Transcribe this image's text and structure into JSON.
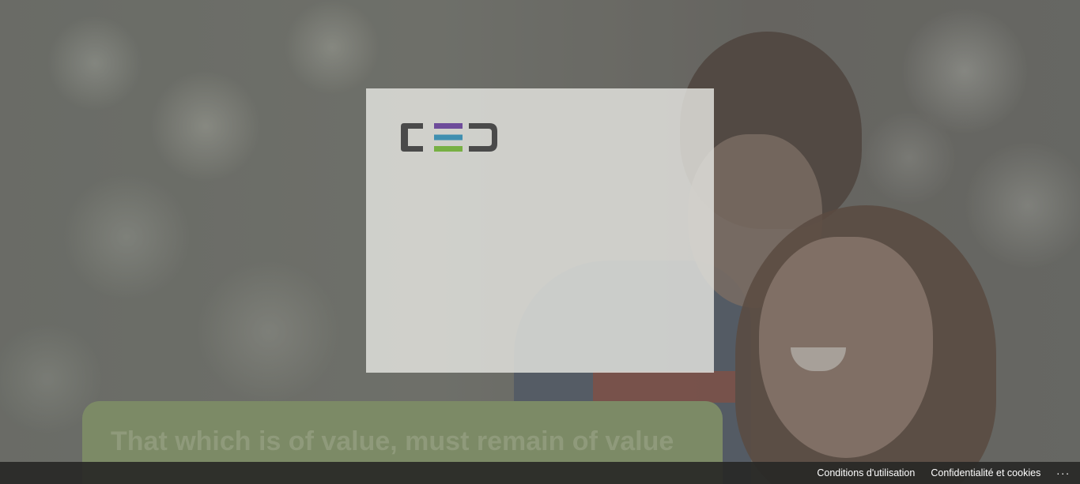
{
  "background": {
    "dim_color": "#5a5a55"
  },
  "tagline": {
    "text": "That which is of value, must remain of value",
    "panel_color": "#7c8a66",
    "text_color": "#8f9a7b"
  },
  "login_card": {
    "logo_text": "CED",
    "logo_colors": {
      "letters": "#4a4a4a",
      "purple": "#6e4c9a",
      "teal": "#3f8fb0",
      "green": "#77b043"
    }
  },
  "footer": {
    "links": [
      {
        "label": "Conditions d'utilisation"
      },
      {
        "label": "Confidentialité et cookies"
      }
    ],
    "more_label": "..."
  }
}
